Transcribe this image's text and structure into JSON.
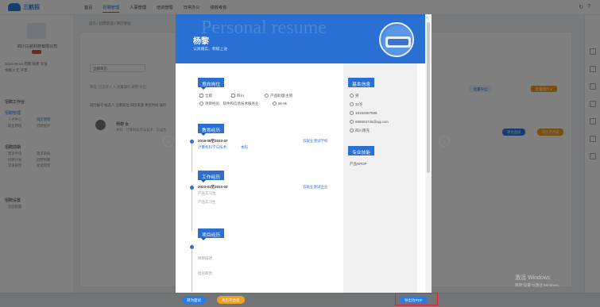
{
  "app": {
    "logo_text": "三航招",
    "topnav": [
      "首页",
      "招聘管理",
      "人事管理",
      "培训管理",
      "日常办公",
      "绩效考核"
    ],
    "crumb": "首页 / 招聘管理 / 简历管理"
  },
  "sidebar": {
    "company": "四川三航科技有限公司",
    "meta1": "2024-06-24 到期   续费 充值",
    "meta2": "余额 0 元         开票",
    "sec1": "招聘工作台",
    "sec2": "招聘管理",
    "sec2_items": [
      "人才中心",
      "简历管理",
      "职位管理",
      "招聘统计"
    ],
    "sec3": "招聘前期",
    "sec3_items": [
      "需求申请",
      "需求审核",
      "招聘计划",
      "招聘预算",
      "渠道管理",
      "面试管理"
    ],
    "sec4": "招聘设置",
    "sec4_items": [
      "流程配置"
    ]
  },
  "main": {
    "select": "全部简历",
    "filter": "筛选: 已选择 0 人  批量操作  刷新  导出",
    "list_head": "简历编号  候选人  应聘职位  简历来源  更新时间  操作",
    "candidate": {
      "name": "杨黎  女",
      "info": "本科 · 计算机科学与技术 · 应届生"
    },
    "right_btn1": "批量导出",
    "right_btn2": "批量操作 ▾",
    "row_btn1": "转为面试",
    "row_btn2": "简历不合适"
  },
  "resume": {
    "bg_title": "Personal resume",
    "name": "杨黎",
    "tagline": "认真踏实、积极上进",
    "intent_title": "意向岗位",
    "intent_row1": [
      "全职",
      "四川",
      "产品助理/主管"
    ],
    "intent_row2": [
      "项目经验、软件和信息技术服务业",
      "8k-9k"
    ],
    "edu_title": "教育经历",
    "edu_period": "2019-09至2023-07",
    "edu_school": "云就业测试学校",
    "edu_major": "计算机科学与技术",
    "edu_degree": "本科",
    "work_title": "工作经历",
    "work_period": "2023-01至2023-03",
    "work_company": "云就业测试企业",
    "work_role": "产品实习生",
    "work_desc": "产品实习生",
    "project_title": "项目经历",
    "project_name_label": "项目描述:",
    "project_role_label": "担任职责:",
    "basic_title": "基本信息",
    "basic_gender": "男",
    "basic_age": "31岁",
    "basic_phone": "18182657596",
    "basic_email": "886504745@qq.com",
    "basic_location": "四川南充",
    "skills_title": "专业技能",
    "skills_item": "产品NPDP",
    "btn_interview": "转为面试",
    "btn_unfit": "简历不合适",
    "btn_export": "导出为PDF"
  },
  "watermark": {
    "line1": "激活 Windows",
    "line2": "转到\"设置\"以激活 Windows。"
  },
  "colors": {
    "brand": "#2a6fd2",
    "orange": "#f0a020",
    "highlight": "#e5202e"
  }
}
